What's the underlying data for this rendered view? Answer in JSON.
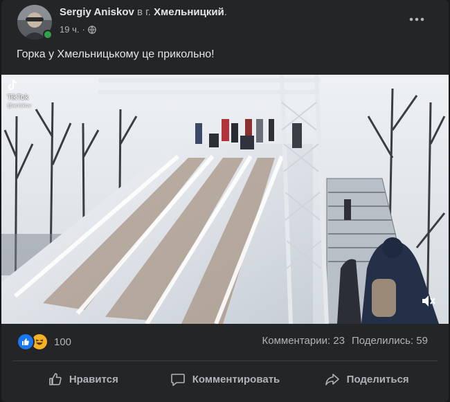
{
  "post": {
    "author": "Sergiy Aniskov",
    "prep": "в г.",
    "place": "Хмельницкий",
    "place_suffix": ".",
    "time": "19 ч.",
    "dot": "·",
    "text": "Горка у Хмельницькому це прикольно!",
    "icons": {
      "audience": "globe-icon",
      "more": "more-options-icon",
      "like_reaction": "like-reaction-icon",
      "haha_reaction": "haha-reaction-icon",
      "mute": "volume-muted-icon"
    },
    "video": {
      "watermark": "TikTok",
      "watermark_handle": "@aniskov"
    }
  },
  "engagement": {
    "reaction_count": "100",
    "comments": "Комментарии: 23",
    "shares": "Поделились: 59"
  },
  "actions": {
    "like": "Нравится",
    "comment": "Комментировать",
    "share": "Поделиться"
  },
  "colors": {
    "background": "#242526",
    "text": "#e4e6eb",
    "secondary_text": "#b0b3b8",
    "like_blue": "#1877f2",
    "online_green": "#31a24c"
  }
}
